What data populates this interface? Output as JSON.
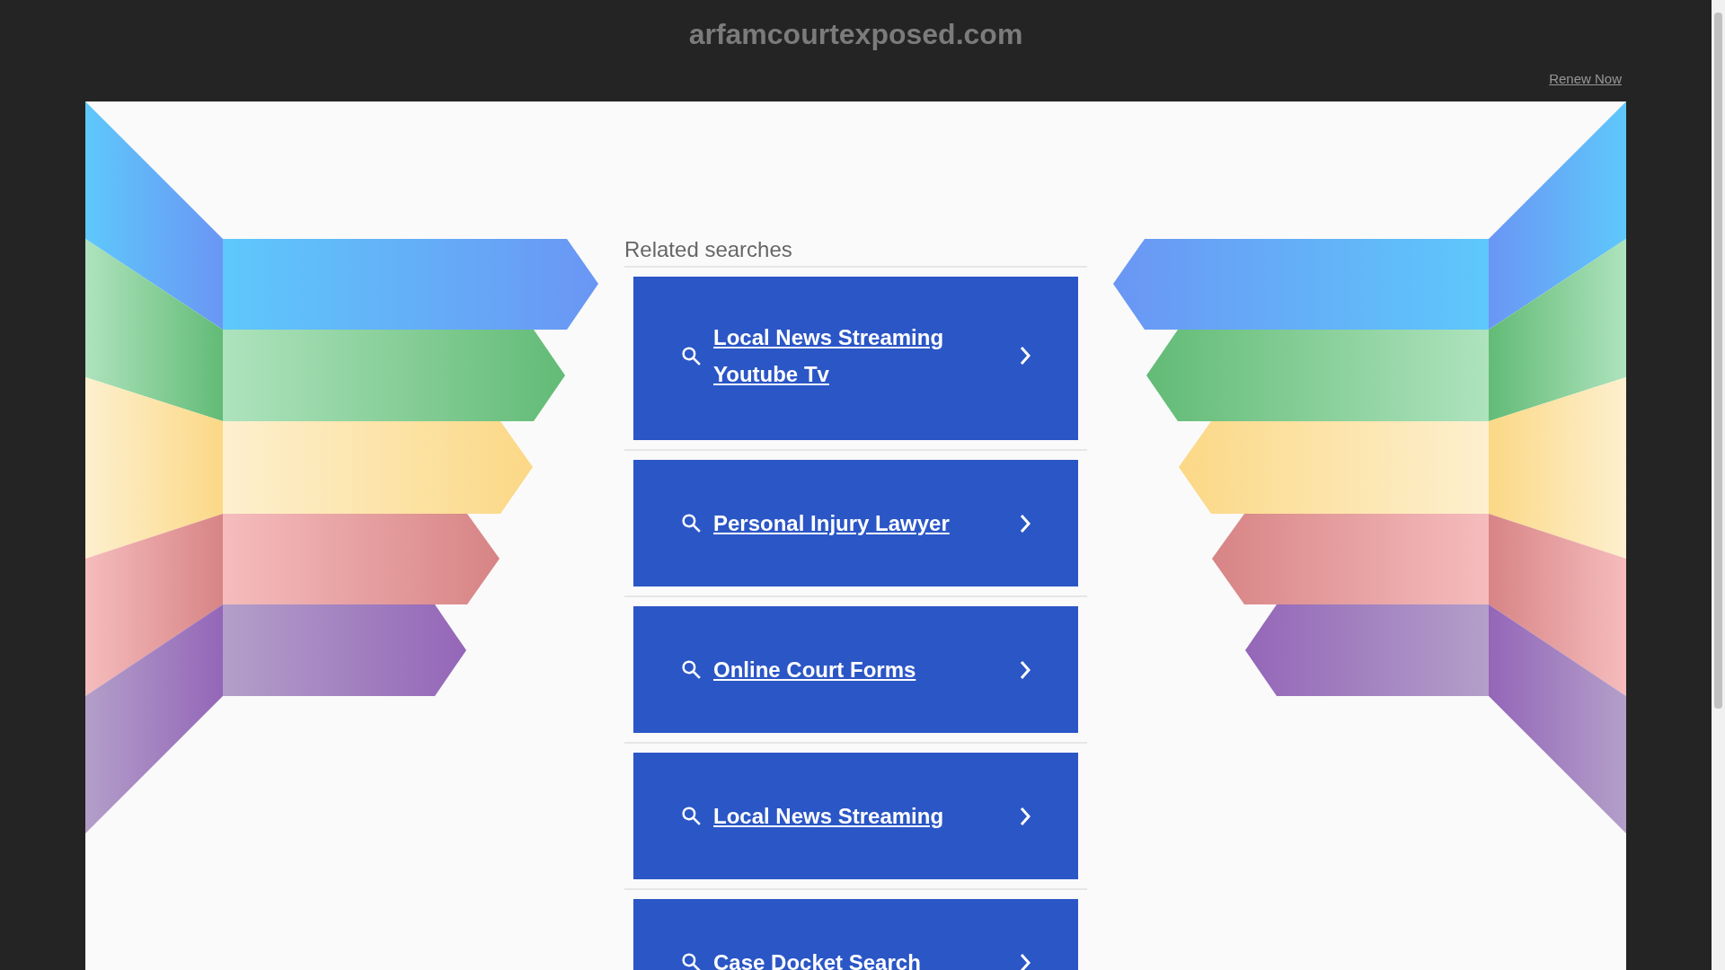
{
  "header": {
    "domain": "arfamcourtexposed.com",
    "renew_link": "Renew Now"
  },
  "related_searches": {
    "heading": "Related searches",
    "items": [
      {
        "label": "Local News Streaming Youtube Tv"
      },
      {
        "label": "Personal Injury Lawyer"
      },
      {
        "label": "Online Court Forms"
      },
      {
        "label": "Local News Streaming"
      },
      {
        "label": "Case Docket Search"
      }
    ]
  }
}
